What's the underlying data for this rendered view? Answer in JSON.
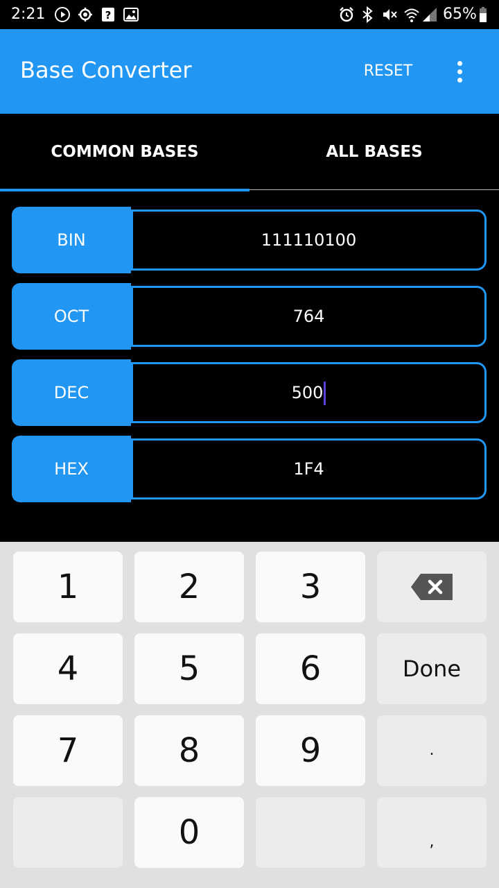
{
  "status_bar": {
    "time": "2:21",
    "icons": [
      "play-icon",
      "settings-icon",
      "help-icon",
      "image-icon",
      "alarm-icon",
      "bluetooth-icon",
      "mute-icon",
      "wifi-icon",
      "signal-icon",
      "battery-icon"
    ],
    "battery": "65%"
  },
  "app_bar": {
    "title": "Base Converter",
    "reset_label": "RESET",
    "more_icon": "more-vert-icon"
  },
  "tabs": [
    {
      "label": "COMMON BASES",
      "selected": true
    },
    {
      "label": "ALL BASES",
      "selected": false
    }
  ],
  "bases": [
    {
      "label": "BIN",
      "value": "111110100"
    },
    {
      "label": "OCT",
      "value": "764"
    },
    {
      "label": "DEC",
      "value": "500"
    },
    {
      "label": "HEX",
      "value": "1F4"
    }
  ],
  "keyboard": {
    "keys": [
      "1",
      "2",
      "3",
      "backspace-icon",
      "4",
      "5",
      "6",
      "Done",
      "7",
      "8",
      "9",
      ".",
      "",
      "0",
      "",
      ","
    ]
  },
  "colors": {
    "accent": "#2196F3",
    "background": "#000000",
    "keyboard_bg": "#E0E0E0",
    "cursor": "#5B3FD6"
  }
}
